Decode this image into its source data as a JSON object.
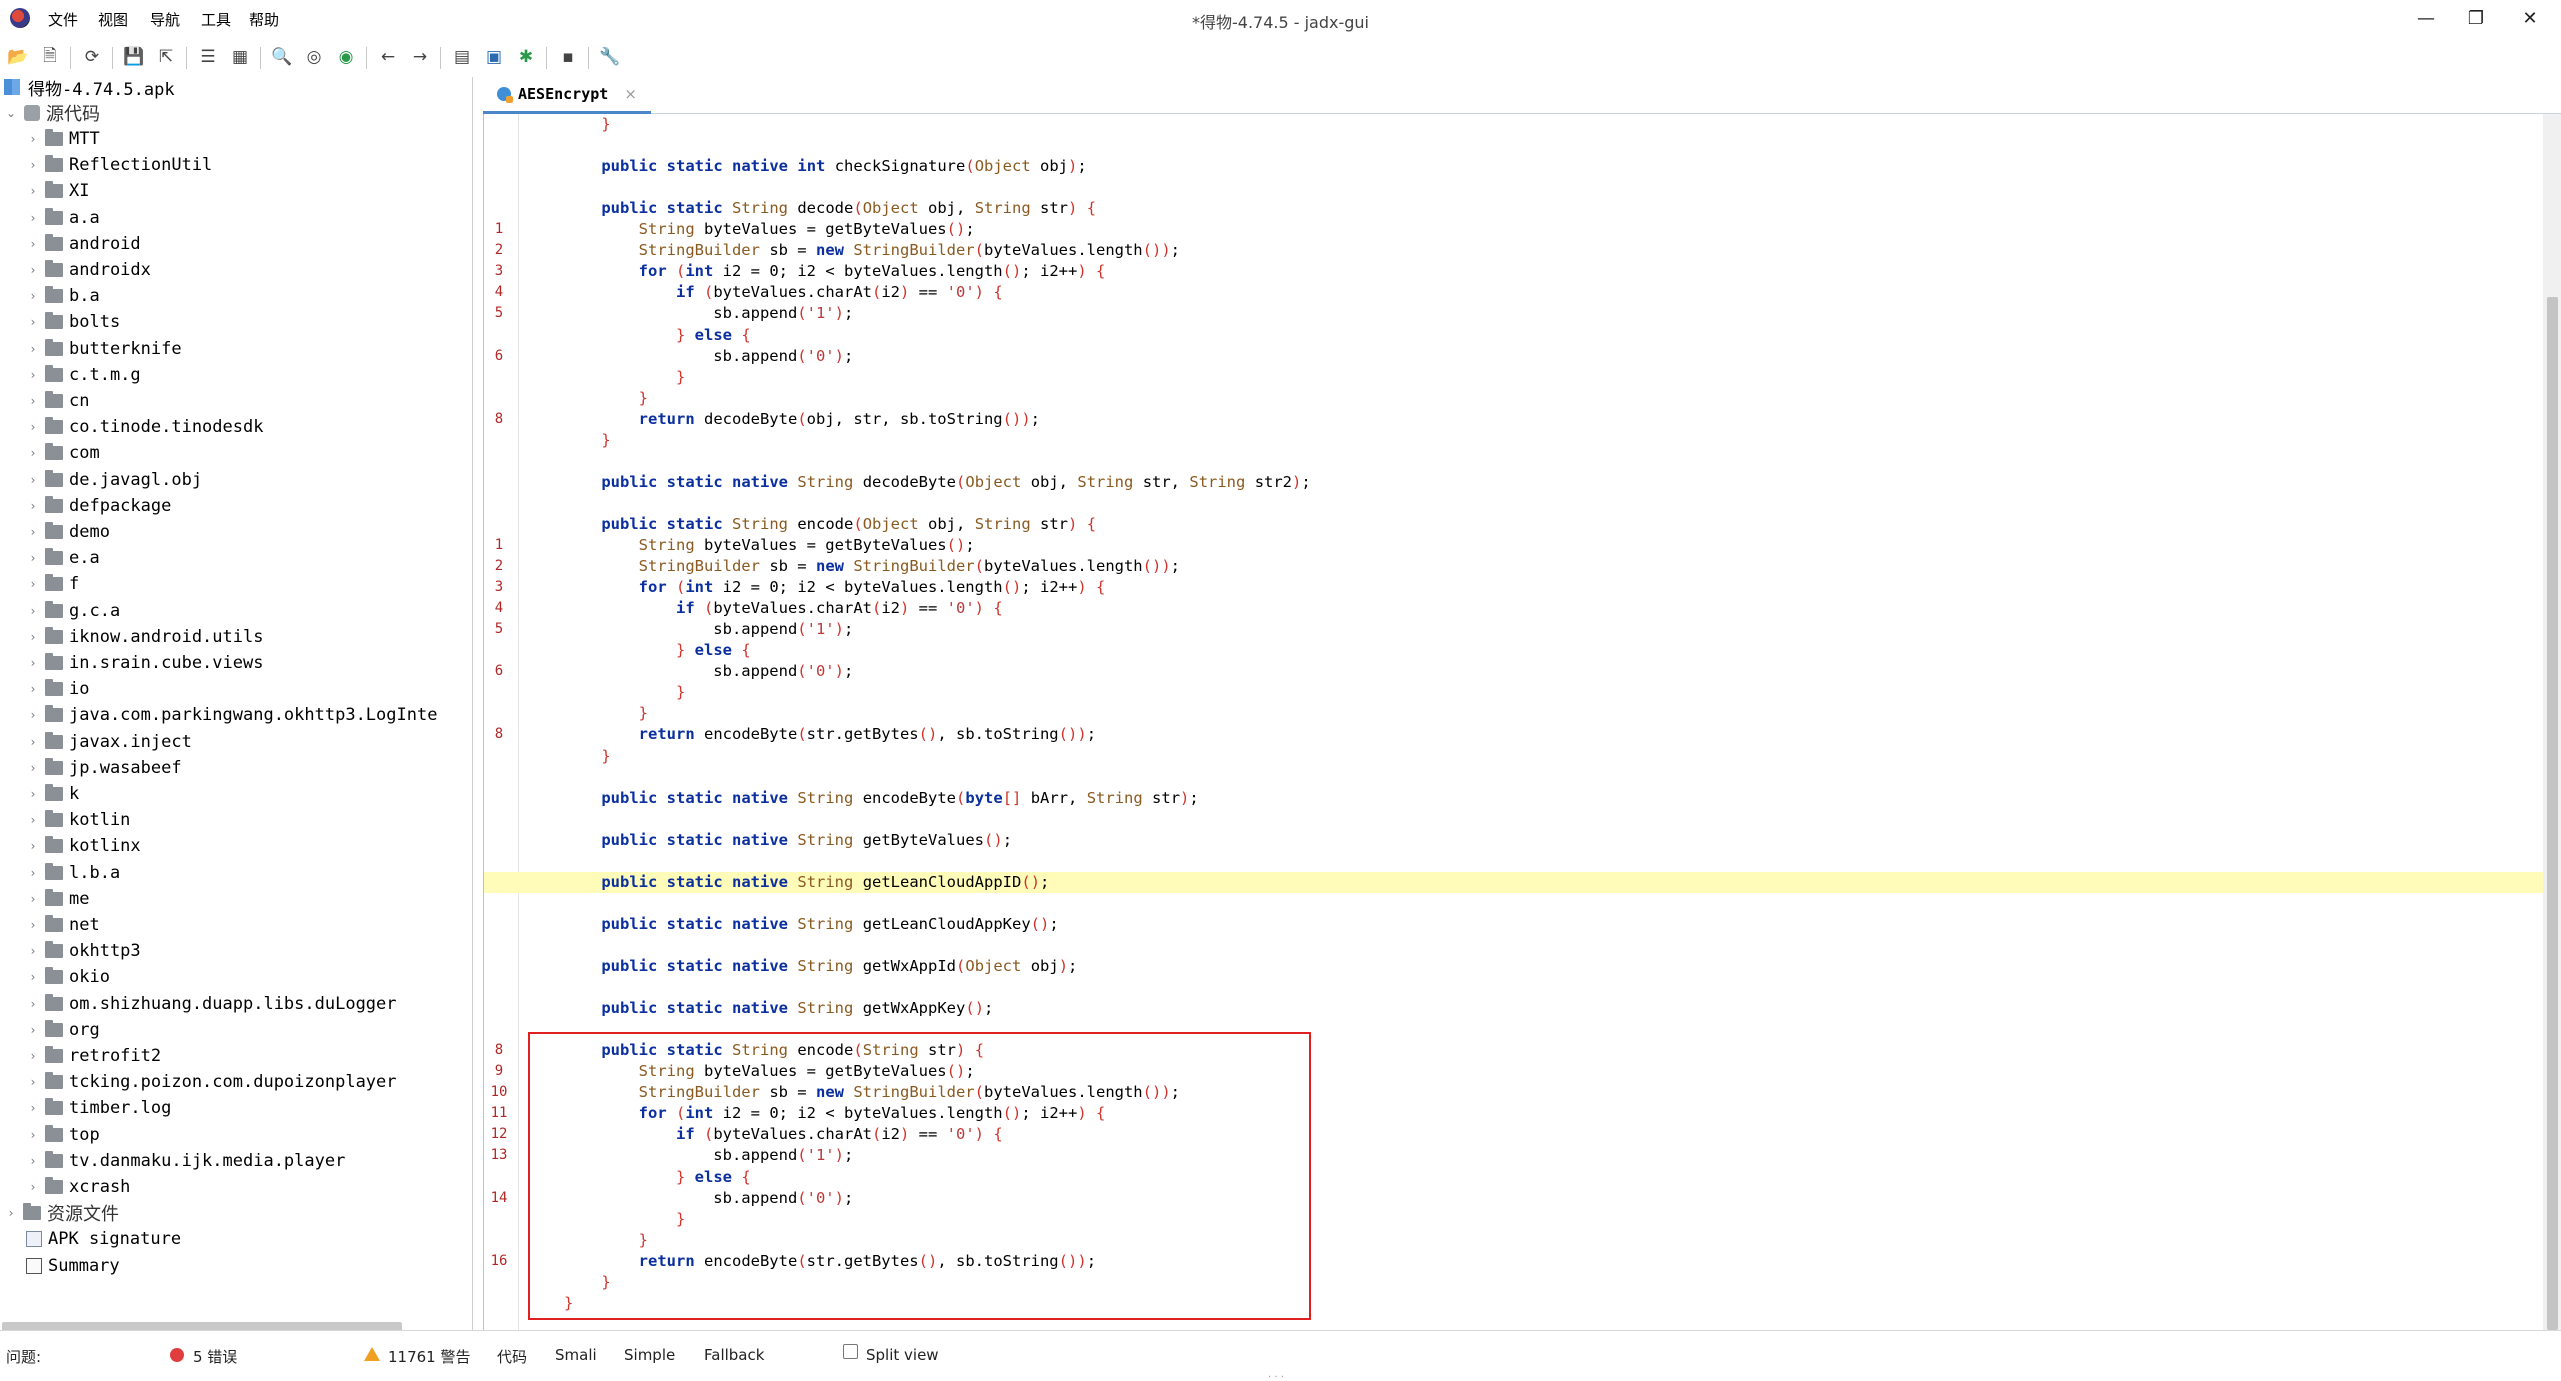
{
  "window": {
    "title": "*得物-4.74.5 - jadx-gui",
    "menu": [
      "文件",
      "视图",
      "导航",
      "工具",
      "帮助"
    ],
    "controls": {
      "minimize": "—",
      "maximize": "❐",
      "close": "✕"
    }
  },
  "toolbar": {
    "icons": [
      "open-file-icon",
      "add-files-icon",
      "reload-icon",
      "save-all-icon",
      "export-icon",
      "sync-tree-icon",
      "flatten-icon",
      "search-icon",
      "find-usage-icon",
      "find-class-icon",
      "back-icon",
      "forward-icon",
      "decompile-icon",
      "bookmark-icon",
      "debug-icon",
      "log-icon",
      "preferences-icon"
    ]
  },
  "tree": {
    "root": "得物-4.74.5.apk",
    "sources": "源代码",
    "packages": [
      "MTT",
      "ReflectionUtil",
      "XI",
      "a.a",
      "android",
      "androidx",
      "b.a",
      "bolts",
      "butterknife",
      "c.t.m.g",
      "cn",
      "co.tinode.tinodesdk",
      "com",
      "de.javagl.obj",
      "defpackage",
      "demo",
      "e.a",
      "f",
      "g.c.a",
      "iknow.android.utils",
      "in.srain.cube.views",
      "io",
      "java.com.parkingwang.okhttp3.LogInte",
      "javax.inject",
      "jp.wasabeef",
      "k",
      "kotlin",
      "kotlinx",
      "l.b.a",
      "me",
      "net",
      "okhttp3",
      "okio",
      "om.shizhuang.duapp.libs.duLogger",
      "org",
      "retrofit2",
      "tcking.poizon.com.dupoizonplayer",
      "timber.log",
      "top",
      "tv.danmaku.ijk.media.player",
      "xcrash"
    ],
    "resources": "资源文件",
    "apk_signature": "APK signature",
    "summary": "Summary"
  },
  "editor": {
    "tab_label": "AESEncrypt",
    "tab_close": "×",
    "lines": [
      {
        "ln": "",
        "code": "    }",
        "hl": false
      },
      {
        "ln": "",
        "code": "",
        "hl": false
      },
      {
        "ln": "",
        "code": "    public static native int checkSignature(Object obj);",
        "hl": false
      },
      {
        "ln": "",
        "code": "",
        "hl": false
      },
      {
        "ln": "",
        "code": "    public static String decode(Object obj, String str) {",
        "hl": false
      },
      {
        "ln": "1",
        "code": "        String byteValues = getByteValues();",
        "hl": false
      },
      {
        "ln": "2",
        "code": "        StringBuilder sb = new StringBuilder(byteValues.length());",
        "hl": false
      },
      {
        "ln": "3",
        "code": "        for (int i2 = 0; i2 < byteValues.length(); i2++) {",
        "hl": false
      },
      {
        "ln": "4",
        "code": "            if (byteValues.charAt(i2) == '0') {",
        "hl": false
      },
      {
        "ln": "5",
        "code": "                sb.append('1');",
        "hl": false
      },
      {
        "ln": "",
        "code": "            } else {",
        "hl": false
      },
      {
        "ln": "6",
        "code": "                sb.append('0');",
        "hl": false
      },
      {
        "ln": "",
        "code": "            }",
        "hl": false
      },
      {
        "ln": "",
        "code": "        }",
        "hl": false
      },
      {
        "ln": "8",
        "code": "        return decodeByte(obj, str, sb.toString());",
        "hl": false
      },
      {
        "ln": "",
        "code": "    }",
        "hl": false
      },
      {
        "ln": "",
        "code": "",
        "hl": false
      },
      {
        "ln": "",
        "code": "    public static native String decodeByte(Object obj, String str, String str2);",
        "hl": false
      },
      {
        "ln": "",
        "code": "",
        "hl": false
      },
      {
        "ln": "",
        "code": "    public static String encode(Object obj, String str) {",
        "hl": false
      },
      {
        "ln": "1",
        "code": "        String byteValues = getByteValues();",
        "hl": false
      },
      {
        "ln": "2",
        "code": "        StringBuilder sb = new StringBuilder(byteValues.length());",
        "hl": false
      },
      {
        "ln": "3",
        "code": "        for (int i2 = 0; i2 < byteValues.length(); i2++) {",
        "hl": false
      },
      {
        "ln": "4",
        "code": "            if (byteValues.charAt(i2) == '0') {",
        "hl": false
      },
      {
        "ln": "5",
        "code": "                sb.append('1');",
        "hl": false
      },
      {
        "ln": "",
        "code": "            } else {",
        "hl": false
      },
      {
        "ln": "6",
        "code": "                sb.append('0');",
        "hl": false
      },
      {
        "ln": "",
        "code": "            }",
        "hl": false
      },
      {
        "ln": "",
        "code": "        }",
        "hl": false
      },
      {
        "ln": "8",
        "code": "        return encodeByte(str.getBytes(), sb.toString());",
        "hl": false
      },
      {
        "ln": "",
        "code": "    }",
        "hl": false
      },
      {
        "ln": "",
        "code": "",
        "hl": false
      },
      {
        "ln": "",
        "code": "    public static native String encodeByte(byte[] bArr, String str);",
        "hl": false
      },
      {
        "ln": "",
        "code": "",
        "hl": false
      },
      {
        "ln": "",
        "code": "    public static native String getByteValues();",
        "hl": false
      },
      {
        "ln": "",
        "code": "",
        "hl": false
      },
      {
        "ln": "",
        "code": "    public static native String getLeanCloudAppID();",
        "hl": true
      },
      {
        "ln": "",
        "code": "",
        "hl": false
      },
      {
        "ln": "",
        "code": "    public static native String getLeanCloudAppKey();",
        "hl": false
      },
      {
        "ln": "",
        "code": "",
        "hl": false
      },
      {
        "ln": "",
        "code": "    public static native String getWxAppId(Object obj);",
        "hl": false
      },
      {
        "ln": "",
        "code": "",
        "hl": false
      },
      {
        "ln": "",
        "code": "    public static native String getWxAppKey();",
        "hl": false
      },
      {
        "ln": "",
        "code": "",
        "hl": false
      },
      {
        "ln": "8",
        "code": "    public static String encode(String str) {",
        "hl": false
      },
      {
        "ln": "9",
        "code": "        String byteValues = getByteValues();",
        "hl": false
      },
      {
        "ln": "10",
        "code": "        StringBuilder sb = new StringBuilder(byteValues.length());",
        "hl": false
      },
      {
        "ln": "11",
        "code": "        for (int i2 = 0; i2 < byteValues.length(); i2++) {",
        "hl": false
      },
      {
        "ln": "12",
        "code": "            if (byteValues.charAt(i2) == '0') {",
        "hl": false
      },
      {
        "ln": "13",
        "code": "                sb.append('1');",
        "hl": false
      },
      {
        "ln": "",
        "code": "            } else {",
        "hl": false
      },
      {
        "ln": "14",
        "code": "                sb.append('0');",
        "hl": false
      },
      {
        "ln": "",
        "code": "            }",
        "hl": false
      },
      {
        "ln": "",
        "code": "        }",
        "hl": false
      },
      {
        "ln": "16",
        "code": "        return encodeByte(str.getBytes(), sb.toString());",
        "hl": false
      },
      {
        "ln": "",
        "code": "    }",
        "hl": false
      },
      {
        "ln": "",
        "code": "}",
        "hl": false
      }
    ]
  },
  "status": {
    "problems_label": "问题:",
    "errors": "5 错误",
    "warnings": "11761 警告",
    "tabs": [
      "代码",
      "Smali",
      "Simple",
      "Fallback"
    ],
    "split_view": "Split view"
  },
  "colors": {
    "highlight": "#fffbb8",
    "selection_box": "#e02020",
    "keyword": "#0b2f9e",
    "line_number": "#b22828"
  }
}
